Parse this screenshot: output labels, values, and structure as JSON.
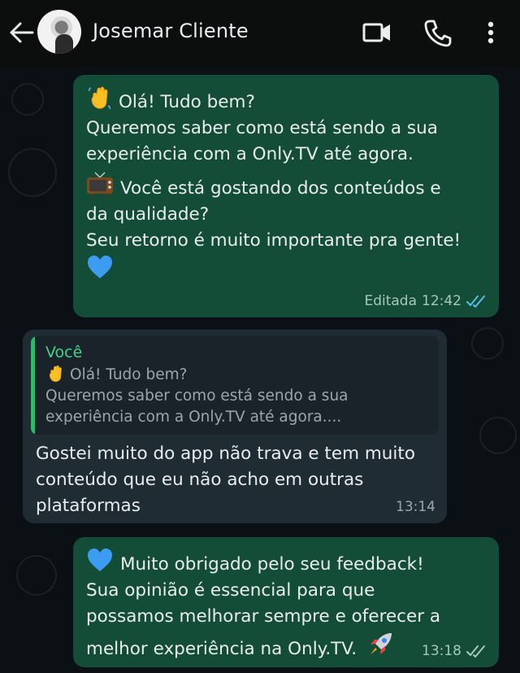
{
  "header": {
    "contact_name": "Josemar Cliente",
    "icons": [
      "back-arrow-icon",
      "video-call-icon",
      "phone-call-icon",
      "more-options-icon"
    ]
  },
  "messages": [
    {
      "direction": "outgoing",
      "lines": [
        "Olá! Tudo bem?",
        "Queremos saber como está sendo a sua",
        "experiência com a Only.TV até agora.",
        "Você está gostando dos conteúdos e",
        "da qualidade?",
        "Seu retorno é muito importante pra gente!"
      ],
      "emojis": [
        "waving-hand-emoji",
        "television-emoji",
        "blue-heart-emoji"
      ],
      "meta_edited": "Editada",
      "time": "12:42",
      "status": "read"
    },
    {
      "direction": "incoming",
      "quote": {
        "author": "Você",
        "lines": [
          "Olá! Tudo bem?",
          "Queremos saber como está sendo a sua",
          "experiência com a Only.TV até agora...."
        ]
      },
      "lines": [
        "Gostei muito do app não trava e tem muito",
        "conteúdo que eu não acho em outras",
        "plataformas"
      ],
      "time": "13:14"
    },
    {
      "direction": "outgoing",
      "lines": [
        "Muito obrigado pelo seu feedback!",
        "Sua opinião é essencial para que",
        "possamos melhorar sempre e oferecer a",
        "melhor experiência na Only.TV."
      ],
      "emojis": [
        "blue-heart-emoji",
        "rocket-emoji"
      ],
      "time": "13:18",
      "status": "delivered"
    }
  ],
  "colors": {
    "outgoing_bubble": "#144d37",
    "incoming_bubble": "#202c33",
    "read_ticks": "#53bdeb",
    "delivered_ticks": "#a8c7b9",
    "quote_accent": "#21c063"
  }
}
